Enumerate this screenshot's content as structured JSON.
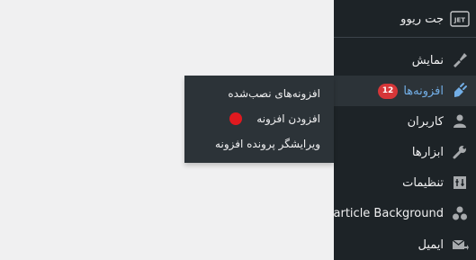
{
  "sidebar": {
    "items": [
      {
        "label": "جت ریوو",
        "icon": "jet-logo-icon"
      },
      {
        "label": "نمایش",
        "icon": "appearance-brush-icon"
      },
      {
        "label": "افزونه‌ها",
        "icon": "plugins-icon",
        "badge": "12",
        "active": true
      },
      {
        "label": "کاربران",
        "icon": "users-icon"
      },
      {
        "label": "ابزارها",
        "icon": "wrench-icon"
      },
      {
        "label": "تنظیمات",
        "icon": "settings-sliders-icon"
      },
      {
        "label": "Particle Background",
        "icon": "particles-icon"
      },
      {
        "label": "ایمیل",
        "icon": "email-icon"
      }
    ]
  },
  "plugins_submenu": {
    "items": [
      {
        "label": "افزونه‌های نصب‌شده"
      },
      {
        "label": "افزودن افزونه"
      },
      {
        "label": "ویرایشگر پرونده افزونه"
      }
    ]
  },
  "colors": {
    "sidebar_bg": "#1d2327",
    "submenu_bg": "#2c3338",
    "accent": "#72aee6",
    "badge": "#d63638",
    "page_bg": "#f0f0f1"
  }
}
